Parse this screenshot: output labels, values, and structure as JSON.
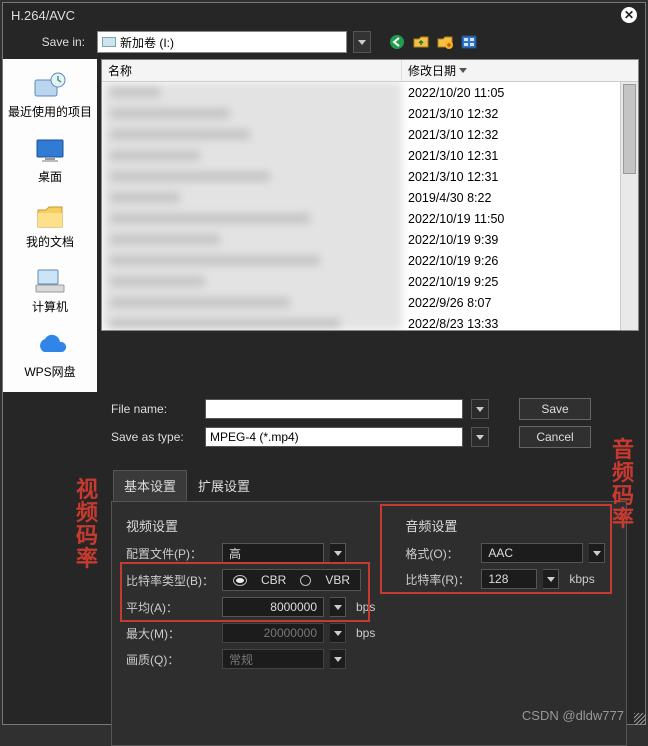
{
  "title": "H.264/AVC",
  "save_in_label": "Save in:",
  "path_value": "新加卷 (I:)",
  "sidebar": [
    {
      "label": "最近使用的项目",
      "icon": "recent-icon"
    },
    {
      "label": "桌面",
      "icon": "desktop-icon"
    },
    {
      "label": "我的文档",
      "icon": "documents-icon"
    },
    {
      "label": "计算机",
      "icon": "computer-icon"
    },
    {
      "label": "WPS网盘",
      "icon": "wps-cloud-icon"
    }
  ],
  "columns": {
    "name": "名称",
    "date": "修改日期"
  },
  "files": [
    {
      "date": "2022/10/20 11:05"
    },
    {
      "date": "2021/3/10 12:32"
    },
    {
      "date": "2021/3/10 12:32"
    },
    {
      "date": "2021/3/10 12:31"
    },
    {
      "date": "2021/3/10 12:31"
    },
    {
      "date": "2019/4/30 8:22"
    },
    {
      "date": "2022/10/19 11:50"
    },
    {
      "date": "2022/10/19 9:39"
    },
    {
      "date": "2022/10/19 9:26"
    },
    {
      "date": "2022/10/19 9:25"
    },
    {
      "date": "2022/9/26 8:07"
    },
    {
      "date": "2022/8/23 13:33"
    }
  ],
  "file_name_label": "File name:",
  "file_name_value": "",
  "save_as_type_label": "Save as type:",
  "save_as_type_value": "MPEG-4 (*.mp4)",
  "save_button": "Save",
  "cancel_button": "Cancel",
  "tabs": {
    "basic": "基本设置",
    "adv": "扩展设置"
  },
  "video": {
    "heading": "视频设置",
    "profile_label": "配置文件(P)：",
    "profile_value": "高",
    "bitrate_type_label": "比特率类型(B)：",
    "bitrate_type": {
      "cbr": "CBR",
      "vbr": "VBR",
      "selected": "CBR"
    },
    "avg_label": "平均(A)：",
    "avg_value": "8000000",
    "avg_unit": "bps",
    "max_label": "最大(M)：",
    "max_value": "20000000",
    "max_unit": "bps",
    "quality_label": "画质(Q)：",
    "quality_value": "常规"
  },
  "audio": {
    "heading": "音频设置",
    "format_label": "格式(O)：",
    "format_value": "AAC",
    "bitrate_label": "比特率(R)：",
    "bitrate_value": "128",
    "bitrate_unit": "kbps"
  },
  "annotations": {
    "left": "视频码率",
    "right": "音频码率"
  },
  "watermark": "CSDN @dldw777"
}
